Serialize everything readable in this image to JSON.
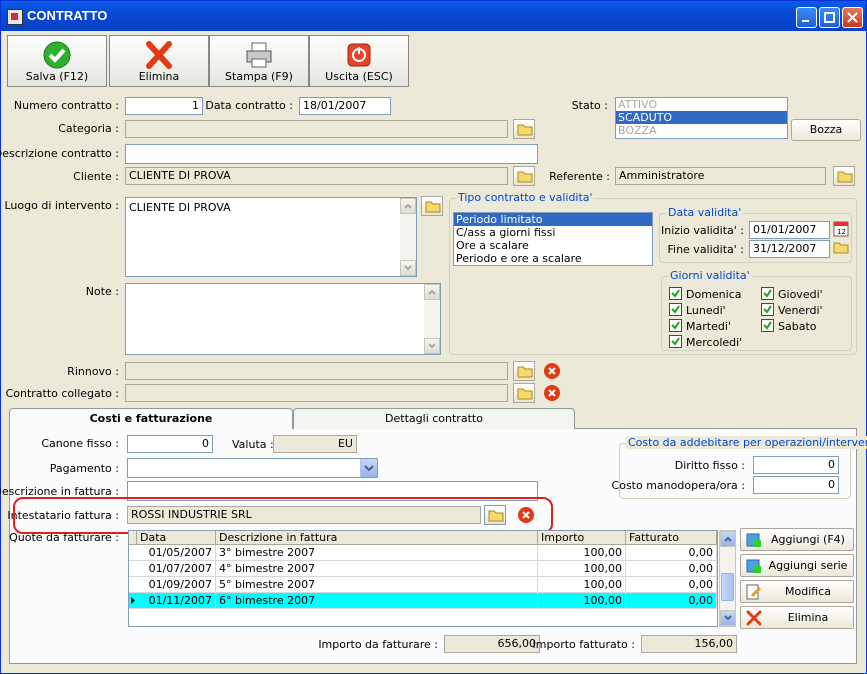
{
  "window": {
    "title": "CONTRATTO"
  },
  "toolbar": {
    "save": "Salva (F12)",
    "delete": "Elimina",
    "print": "Stampa (F9)",
    "exit": "Uscita (ESC)"
  },
  "form": {
    "numero_label": "Numero contratto :",
    "numero": "1",
    "data_label": "Data contratto :",
    "data": "18/01/2007",
    "stato_label": "Stato :",
    "stato_options": [
      "ATTIVO",
      "SCADUTO",
      "BOZZA"
    ],
    "bozza_button": "Bozza",
    "categoria_label": "Categoria :",
    "categoria": "",
    "descrizione_label": "Descrizione contratto :",
    "descrizione": "",
    "cliente_label": "Cliente :",
    "cliente": "CLIENTE DI PROVA",
    "referente_label": "Referente :",
    "referente": "Amministratore",
    "luogo_label": "Luogo di intervento :",
    "luogo": "CLIENTE DI PROVA",
    "note_label": "Note :",
    "note": "",
    "rinnovo_label": "Rinnovo :",
    "rinnovo": "",
    "collegato_label": "Contratto collegato :",
    "collegato": ""
  },
  "tipo": {
    "title": "Tipo contratto e validita'",
    "options": [
      "Periodo limitato",
      "C/ass a giorni fissi",
      "Ore a scalare",
      "Periodo e ore a scalare"
    ],
    "selected_index": 0
  },
  "validita": {
    "title": "Data validita'",
    "inizio_label": "Inizio validita' :",
    "inizio": "01/01/2007",
    "fine_label": "Fine validita' :",
    "fine": "31/12/2007"
  },
  "giorni": {
    "title": "Giorni validita'",
    "col1": [
      "Domenica",
      "Lunedi'",
      "Martedi'",
      "Mercoledi'"
    ],
    "col2": [
      "Giovedi'",
      "Venerdi'",
      "Sabato"
    ]
  },
  "tabs": {
    "costi": "Costi e fatturazione",
    "dettagli": "Dettagli contratto"
  },
  "costi": {
    "canone_label": "Canone fisso :",
    "canone": "0",
    "valuta_label": "Valuta :",
    "valuta": "EU",
    "pagamento_label": "Pagamento :",
    "pagamento": "",
    "descfatt_label": "Descrizione in fattura :",
    "descfatt": "",
    "intestatario_label": "Intestatario fattura :",
    "intestatario": "ROSSI INDUSTRIE SRL",
    "quote_label": "Quote da fatturare :"
  },
  "addebito": {
    "title": "Costo da addebitare per operazioni/interventi",
    "diritto_label": "Diritto fisso :",
    "diritto": "0",
    "manodopera_label": "Costo manodopera/ora :",
    "manodopera": "0"
  },
  "quote": {
    "headers": [
      "Data",
      "Descrizione in fattura",
      "Importo",
      "Fatturato"
    ],
    "rows": [
      [
        "01/05/2007",
        "3° bimestre 2007",
        "100,00",
        "0,00"
      ],
      [
        "01/07/2007",
        "4° bimestre 2007",
        "100,00",
        "0,00"
      ],
      [
        "01/09/2007",
        "5° bimestre 2007",
        "100,00",
        "0,00"
      ],
      [
        "01/11/2007",
        "6° bimestre 2007",
        "100,00",
        "0,00"
      ]
    ],
    "selected_row": 3
  },
  "actions": {
    "add": "Aggiungi (F4)",
    "add_series": "Aggiungi serie",
    "edit": "Modifica",
    "delete": "Elimina"
  },
  "totals": {
    "da_fatturare_label": "Importo da fatturare :",
    "da_fatturare": "656,00",
    "fatturato_label": "Importo fatturato :",
    "fatturato": "156,00"
  },
  "colors": {
    "selection": "#316ac5",
    "row_highlight": "#00ffff",
    "highlight_ring": "#e0201a",
    "titlebar": "#0a49d6"
  }
}
